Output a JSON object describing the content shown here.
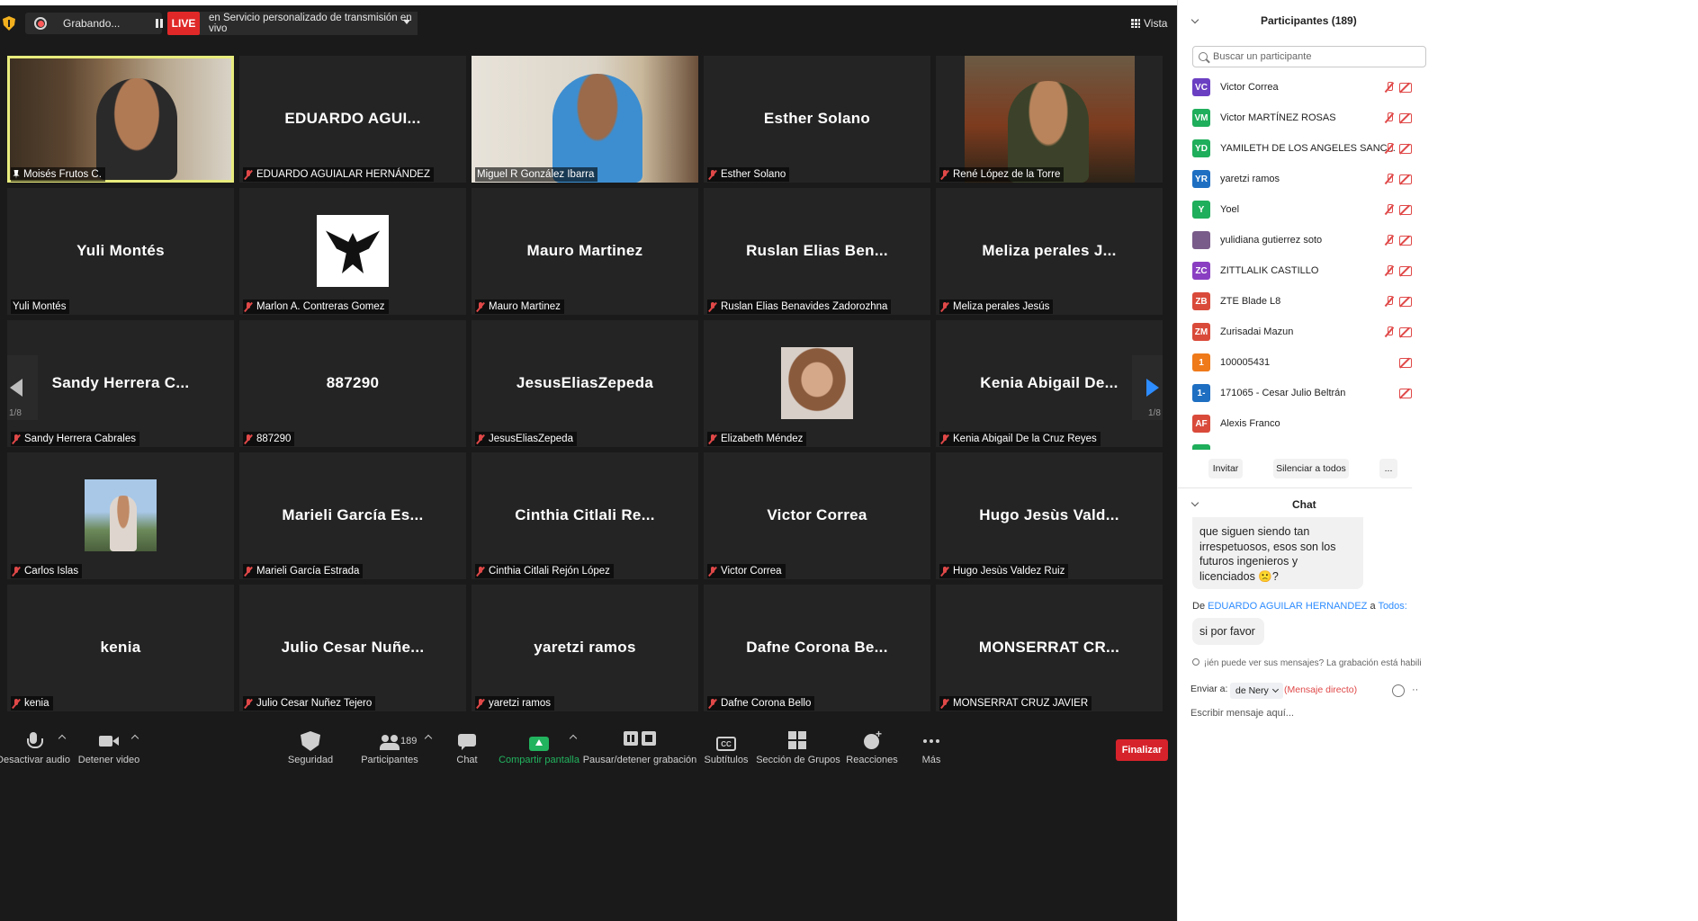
{
  "topbar": {
    "recording_label": "Grabando...",
    "live_badge": "LIVE",
    "stream_label": "en Servicio personalizado de transmisión en vivo",
    "view_label": "Vista"
  },
  "tiles": [
    {
      "big": "",
      "label": "Moisés Frutos C.",
      "kind": "video",
      "video": "moises",
      "active": true,
      "pinned": true,
      "muted": false
    },
    {
      "big": "EDUARDO AGUI...",
      "label": "EDUARDO AGUIALAR HERNÁNDEZ",
      "kind": "name",
      "muted": true
    },
    {
      "big": "",
      "label": "Miguel R González Ibarra",
      "kind": "video",
      "video": "miguel",
      "muted": false
    },
    {
      "big": "Esther Solano",
      "label": "Esther Solano",
      "kind": "name",
      "muted": true
    },
    {
      "big": "",
      "label": "René López de la Torre",
      "kind": "video",
      "video": "rene",
      "muted": true
    },
    {
      "big": "Yuli Montés",
      "label": "Yuli Montés",
      "kind": "name",
      "muted": false
    },
    {
      "big": "",
      "label": "Marlon A. Contreras Gomez",
      "kind": "avatar",
      "avatar": "eagle",
      "muted": true
    },
    {
      "big": "Mauro Martinez",
      "label": "Mauro Martinez",
      "kind": "name",
      "muted": true
    },
    {
      "big": "Ruslan Elias Ben...",
      "label": "Ruslan Elias Benavides Zadorozhna",
      "kind": "name",
      "muted": true
    },
    {
      "big": "Meliza perales J...",
      "label": "Meliza perales Jesús",
      "kind": "name",
      "muted": true
    },
    {
      "big": "Sandy Herrera C...",
      "label": "Sandy Herrera Cabrales",
      "kind": "name",
      "muted": true
    },
    {
      "big": "887290",
      "label": "887290",
      "kind": "name",
      "muted": true
    },
    {
      "big": "JesusEliasZepeda",
      "label": "JesusEliasZepeda",
      "kind": "name",
      "muted": true
    },
    {
      "big": "",
      "label": "Elizabeth Méndez",
      "kind": "avatar",
      "avatar": "liz",
      "muted": true
    },
    {
      "big": "Kenia Abigail De...",
      "label": "Kenia Abigail De la Cruz Reyes",
      "kind": "name",
      "muted": true
    },
    {
      "big": "",
      "label": "Carlos Islas",
      "kind": "avatar",
      "avatar": "carlos",
      "muted": true
    },
    {
      "big": "Marieli García Es...",
      "label": "Marieli García Estrada",
      "kind": "name",
      "muted": true
    },
    {
      "big": "Cinthia Citlali Re...",
      "label": "Cinthia Citlali Rejón López",
      "kind": "name",
      "muted": true
    },
    {
      "big": "Victor Correa",
      "label": "Victor Correa",
      "kind": "name",
      "muted": true
    },
    {
      "big": "Hugo Jesùs Vald...",
      "label": "Hugo Jesùs Valdez Ruiz",
      "kind": "name",
      "muted": true
    },
    {
      "big": "kenia",
      "label": "kenia",
      "kind": "name",
      "muted": true
    },
    {
      "big": "Julio Cesar Nuñe...",
      "label": "Julio Cesar Nuñez Tejero",
      "kind": "name",
      "muted": true
    },
    {
      "big": "yaretzi ramos",
      "label": "yaretzi ramos",
      "kind": "name",
      "muted": true
    },
    {
      "big": "Dafne Corona Be...",
      "label": "Dafne Corona Bello",
      "kind": "name",
      "muted": true
    },
    {
      "big": "MONSERRAT  CR...",
      "label": "MONSERRAT CRUZ JAVIER",
      "kind": "name",
      "muted": true
    }
  ],
  "paging": {
    "left": "1/8",
    "right": "1/8"
  },
  "toolbar": {
    "audio": "Desactivar audio",
    "video": "Detener video",
    "security": "Seguridad",
    "participants": "Participantes",
    "participants_count": "189",
    "chat": "Chat",
    "share": "Compartir pantalla",
    "record": "Pausar/detener grabación",
    "captions": "Subtítulos",
    "captions_icon_text": "CC",
    "groups": "Sección de Grupos",
    "reactions": "Reacciones",
    "more": "Más",
    "end": "Finalizar"
  },
  "panel": {
    "title": "Participantes (189)",
    "search_placeholder": "Buscar un participante",
    "participants": [
      {
        "initials": "VC",
        "name": "Victor Correa",
        "color": "#6b3fc2",
        "mic": true
      },
      {
        "initials": "VM",
        "name": "Victor MARTÍNEZ ROSAS",
        "color": "#1fae5b",
        "mic": true
      },
      {
        "initials": "YD",
        "name": "YAMILETH DE LOS ANGELES SANC...",
        "color": "#1fae5b",
        "mic": true
      },
      {
        "initials": "YR",
        "name": "yaretzi ramos",
        "color": "#1e6fc2",
        "mic": true
      },
      {
        "initials": "Y",
        "name": "Yoel",
        "color": "#1fae5b",
        "mic": true
      },
      {
        "initials": "",
        "name": "yulidiana gutierrez soto",
        "color": "#7a5c8a",
        "mic": true
      },
      {
        "initials": "ZC",
        "name": "ZITTLALIK CASTILLO",
        "color": "#8a3fc2",
        "mic": true
      },
      {
        "initials": "ZB",
        "name": "ZTE Blade L8",
        "color": "#d94a3a",
        "mic": true
      },
      {
        "initials": "ZM",
        "name": "Zurisadai Mazun",
        "color": "#d94a3a",
        "mic": true
      },
      {
        "initials": "1",
        "name": "100005431",
        "color": "#ef7a1a",
        "mic": false
      },
      {
        "initials": "1-",
        "name": "171065 - Cesar Julio Beltrán",
        "color": "#1e6fc2",
        "mic": false
      },
      {
        "initials": "AF",
        "name": "Alexis Franco",
        "color": "#d94a3a",
        "mic": false,
        "nocam": true
      }
    ],
    "invite": "Invitar",
    "mute_all": "Silenciar a todos",
    "more": "...",
    "chat_title": "Chat",
    "messages": {
      "prev_text": "que siguen siendo tan irrespetuosos, esos son los futuros ingenieros y licenciados 🙁?",
      "from_prefix": "De",
      "from_name": "EDUARDO AGUILAR HERNANDEZ",
      "from_to_word": "a",
      "from_to_target": "Todos:",
      "last_text": "si por favor"
    },
    "privacy_note": "¡ién puede ver sus mensajes? La grabación está habili",
    "send_to_label": "Enviar a:",
    "send_to_value": "de Nery",
    "direct_label": "(Mensaje directo)",
    "input_placeholder": "Escribir mensaje aquí..."
  }
}
